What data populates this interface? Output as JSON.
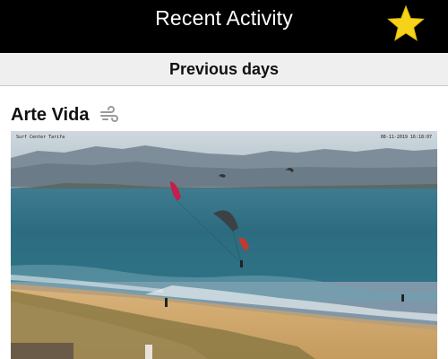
{
  "header": {
    "title": "Recent Activity",
    "favorite_icon": "star-icon",
    "star_color": "#f6d21a"
  },
  "section": {
    "title": "Previous days"
  },
  "spot": {
    "name": "Arte Vida",
    "wind_icon": "wind-icon",
    "webcam": {
      "label": "Surf Center Tarifa",
      "timestamp": "08-11-2019 16:18:07"
    }
  }
}
